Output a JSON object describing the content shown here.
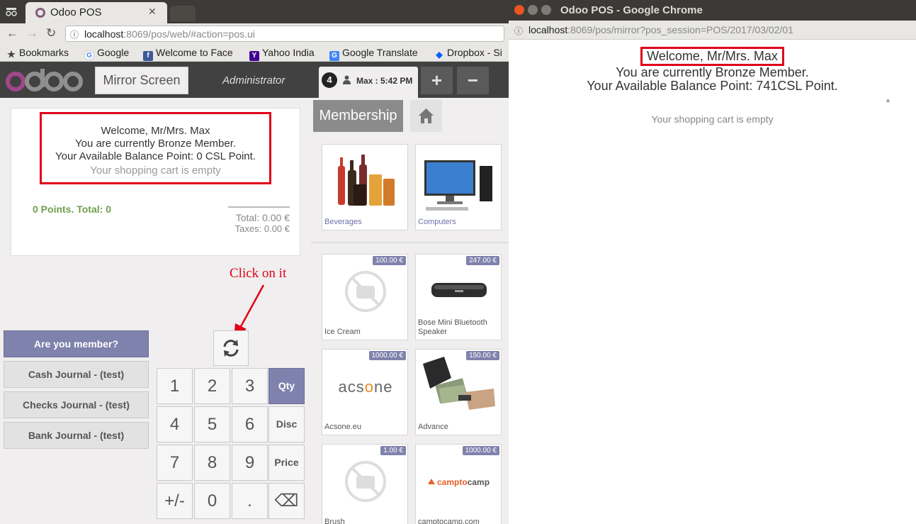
{
  "left_window": {
    "tab_title": "Odoo POS",
    "tab_close": "✕",
    "url_host": "localhost",
    "url_path": ":8069/pos/web/#action=pos.ui",
    "bookmarks": [
      {
        "label": "Bookmarks",
        "icon": "star-icon"
      },
      {
        "label": "Google",
        "icon": "google-icon"
      },
      {
        "label": "Welcome to Face",
        "icon": "facebook-icon"
      },
      {
        "label": "Yahoo India",
        "icon": "yahoo-icon"
      },
      {
        "label": "Google Translate",
        "icon": "translate-icon"
      },
      {
        "label": "Dropbox - Si",
        "icon": "dropbox-icon"
      }
    ]
  },
  "pos": {
    "logo": "odoo",
    "mirror_button": "Mirror Screen",
    "user": "Administrator",
    "order": {
      "number": "4",
      "label": "Max : 5:42 PM"
    },
    "plus": "+",
    "minus": "−",
    "welcome": {
      "line1": "Welcome, Mr/Mrs. Max",
      "line2": "You are currently Bronze Member.",
      "line3": "Your Available Balance Point: 0 CSL Point.",
      "empty": "Your shopping cart is empty"
    },
    "points_total": "0 Points. Total: 0",
    "total": "Total: 0.00 €",
    "taxes": "Taxes: 0.00 €",
    "annotation": "Click on it",
    "payment_buttons": [
      "Are you member?",
      "Cash Journal - (test)",
      "Checks Journal - (test)",
      "Bank Journal - (test)"
    ],
    "numpad": {
      "k1": "1",
      "k2": "2",
      "k3": "3",
      "qty": "Qty",
      "k4": "4",
      "k5": "5",
      "k6": "6",
      "disc": "Disc",
      "k7": "7",
      "k8": "8",
      "k9": "9",
      "price": "Price",
      "sign": "+/-",
      "k0": "0",
      "dot": ".",
      "backspace": "⌫"
    },
    "category_breadcrumb": "Membership",
    "categories": [
      {
        "name": "Beverages"
      },
      {
        "name": "Computers"
      }
    ],
    "products": [
      {
        "name": "Ice Cream",
        "price": "100.00 €"
      },
      {
        "name": "Bose Mini Bluetooth Speaker",
        "price": "247.00 €"
      },
      {
        "name": "Acsone.eu",
        "price": "1000.00 €",
        "logo_text": "acsone"
      },
      {
        "name": "Advance",
        "price": "150.00 €"
      },
      {
        "name": "Brush",
        "price": "1.00 €"
      },
      {
        "name": "camptocamp.com",
        "price": "1000.00 €",
        "logo_text": "camptocamp"
      }
    ]
  },
  "right_window": {
    "title": "Odoo POS - Google Chrome",
    "url_host": "localhost",
    "url_path": ":8069/pos/mirror?pos_session=POS/2017/03/02/01",
    "welcome": "Welcome, Mr/Mrs. Max",
    "member": "You are currently Bronze Member.",
    "balance": "Your Available Balance Point: 741CSL Point.",
    "empty": "Your shopping cart is empty"
  },
  "colors": {
    "highlight_red": "#e0001a",
    "odoo_purple": "#875a7b",
    "accent_button": "#7f82ac",
    "points_green": "#6ea04f"
  }
}
